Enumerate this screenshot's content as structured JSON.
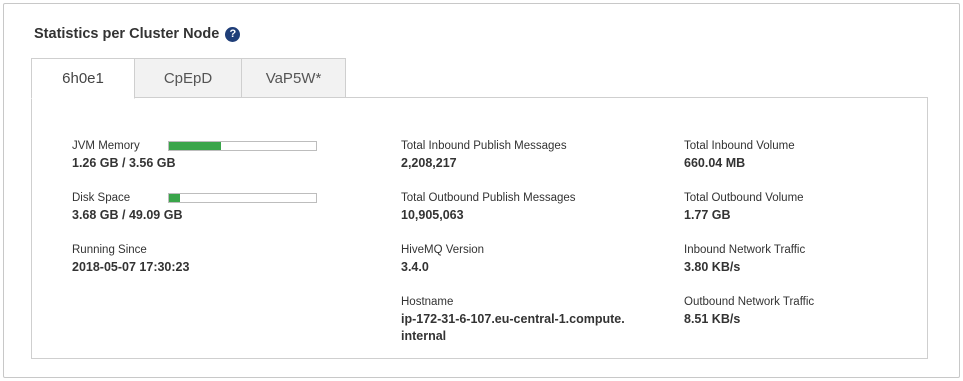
{
  "header": {
    "title": "Statistics per Cluster Node",
    "help_icon": "question-circle-icon"
  },
  "tabs": [
    {
      "label": "6h0e1",
      "active": true
    },
    {
      "label": "CpEpD",
      "active": false
    },
    {
      "label": "VaP5W*",
      "active": false
    }
  ],
  "colors": {
    "bar_fill": "#3aa54a",
    "help_icon": "#1f3e78"
  },
  "stats": {
    "jvm_memory": {
      "label": "JVM Memory",
      "value": "1.26 GB / 3.56 GB",
      "fraction": 0.354
    },
    "disk_space": {
      "label": "Disk Space",
      "value": "3.68 GB / 49.09 GB",
      "fraction": 0.075
    },
    "running_since": {
      "label": "Running Since",
      "value": "2018-05-07 17:30:23"
    },
    "total_inbound_publish": {
      "label": "Total Inbound Publish Messages",
      "value": "2,208,217"
    },
    "total_outbound_publish": {
      "label": "Total Outbound Publish Messages",
      "value": "10,905,063"
    },
    "hivemq_version": {
      "label": "HiveMQ Version",
      "value": "3.4.0"
    },
    "hostname": {
      "label": "Hostname",
      "value": "ip-172-31-6-107.eu-central-1.compute.internal"
    },
    "total_inbound_volume": {
      "label": "Total Inbound Volume",
      "value": "660.04 MB"
    },
    "total_outbound_volume": {
      "label": "Total Outbound Volume",
      "value": "1.77 GB"
    },
    "inbound_network_traffic": {
      "label": "Inbound Network Traffic",
      "value": "3.80 KB/s"
    },
    "outbound_network_traffic": {
      "label": "Outbound Network Traffic",
      "value": "8.51 KB/s"
    }
  }
}
